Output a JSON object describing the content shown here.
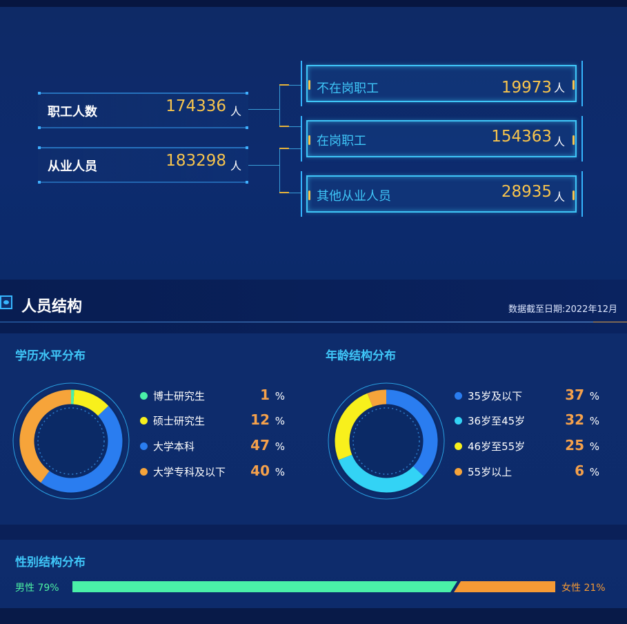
{
  "summary": {
    "workers": {
      "label": "职工人数",
      "value": "174336",
      "unit": "人"
    },
    "employed": {
      "label": "从业人员",
      "value": "183298",
      "unit": "人"
    }
  },
  "categories": [
    {
      "label": "不在岗职工",
      "value": "19973",
      "unit": "人"
    },
    {
      "label": "在岗职工",
      "value": "154363",
      "unit": "人"
    },
    {
      "label": "其他从业人员",
      "value": "28935",
      "unit": "人"
    }
  ],
  "structure": {
    "title": "人员结构",
    "date_note": "数据截至日期:2022年12月"
  },
  "chart_data": [
    {
      "type": "pie",
      "title": "学历水平分布",
      "categories": [
        "博士研究生",
        "硕士研究生",
        "大学本科",
        "大学专科及以下"
      ],
      "values": [
        1,
        12,
        47,
        40
      ],
      "unit": "%",
      "colors": [
        "#4af0a8",
        "#f8f01c",
        "#2a7df0",
        "#f6a43a"
      ]
    },
    {
      "type": "pie",
      "title": "年龄结构分布",
      "categories": [
        "35岁及以下",
        "36岁至45岁",
        "46岁至55岁",
        "55岁以上"
      ],
      "values": [
        37,
        32,
        25,
        6
      ],
      "unit": "%",
      "colors": [
        "#2a7df0",
        "#33d3f5",
        "#f8f01c",
        "#f6a43a"
      ]
    },
    {
      "type": "bar",
      "title": "性别结构分布",
      "categories": [
        "男性",
        "女性"
      ],
      "values": [
        79,
        21
      ],
      "unit": "%",
      "colors": [
        "#4af0a8",
        "#f59a35"
      ]
    }
  ],
  "gender": {
    "male_label": "男性  79%",
    "female_label": "女性 21%"
  },
  "pct_sign": "%"
}
